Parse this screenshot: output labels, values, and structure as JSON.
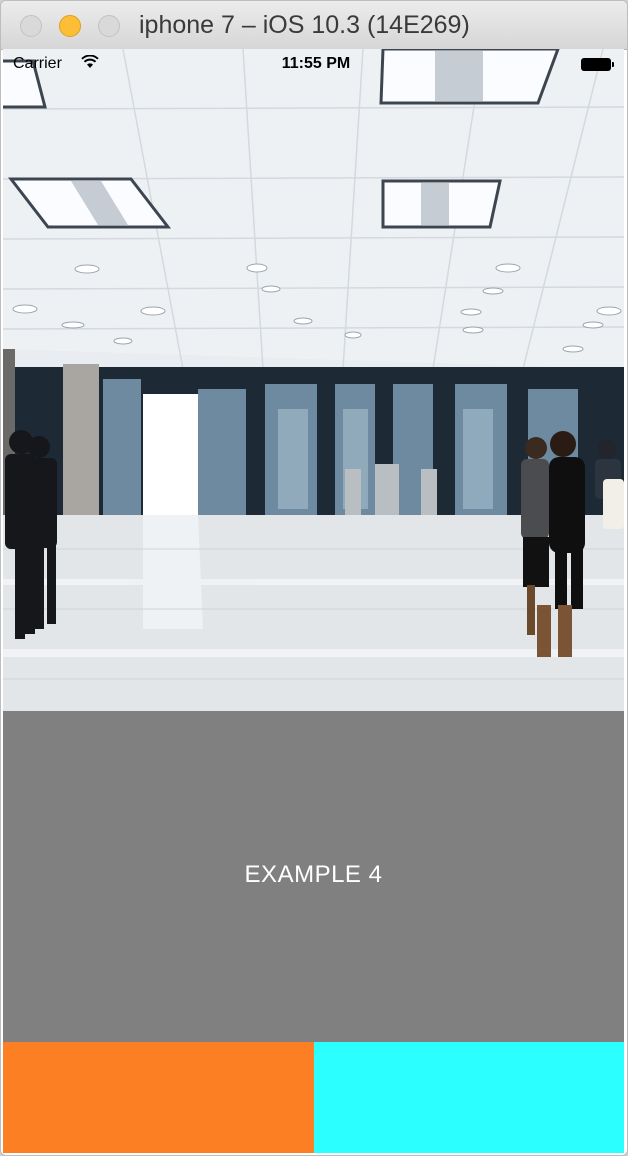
{
  "window": {
    "title": "iphone 7 – iOS 10.3 (14E269)",
    "buttons": [
      "close",
      "minimize",
      "zoom"
    ]
  },
  "status_bar": {
    "carrier": "Carrier",
    "time": "11:55 PM",
    "icons": [
      "wifi-icon",
      "battery-icon"
    ]
  },
  "hero_image": {
    "subject": "office lobby photo"
  },
  "example": {
    "label": "EXAMPLE 4",
    "background": "#808080"
  },
  "blocks": {
    "left_color": "#fd7f23",
    "right_color": "#2bffff"
  }
}
